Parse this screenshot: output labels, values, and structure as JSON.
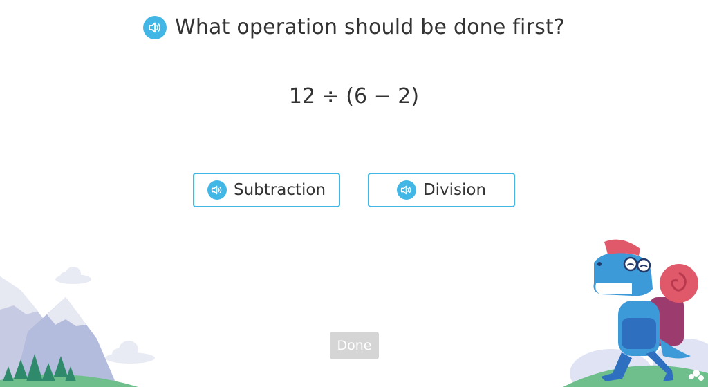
{
  "question": {
    "text": "What operation should be done first?",
    "audio_icon": "speaker-icon"
  },
  "expression": "12 ÷ (6 − 2)",
  "choices": [
    {
      "label": "Subtraction",
      "icon": "speaker-icon"
    },
    {
      "label": "Division",
      "icon": "speaker-icon"
    }
  ],
  "done_button": {
    "label": "Done",
    "state": "disabled"
  },
  "colors": {
    "accent": "#42b6e4",
    "text": "#333333",
    "done_disabled": "#d5d5d5"
  }
}
